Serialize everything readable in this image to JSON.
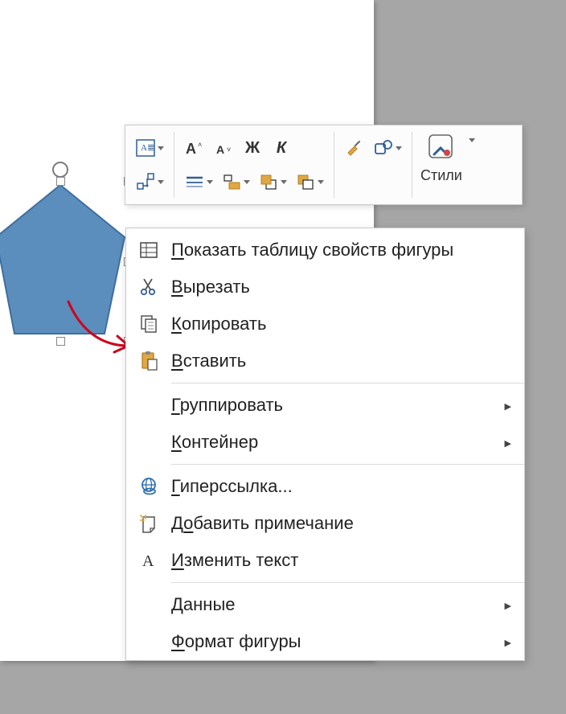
{
  "toolbar": {
    "styles_label": "Стили",
    "bold_glyph": "Ж",
    "italic_glyph": "К"
  },
  "context_menu": {
    "items": [
      {
        "icon": "properties-table-icon",
        "label_pre": "",
        "ul": "П",
        "label_post": "оказать таблицу свойств фигуры",
        "submenu": false
      },
      {
        "icon": "cut-icon",
        "label_pre": "",
        "ul": "В",
        "label_post": "ырезать",
        "submenu": false
      },
      {
        "icon": "copy-icon",
        "label_pre": "",
        "ul": "К",
        "label_post": "опировать",
        "submenu": false
      },
      {
        "icon": "paste-icon",
        "label_pre": "",
        "ul": "В",
        "label_post": "ставить",
        "submenu": false
      },
      {
        "sep": true
      },
      {
        "icon": "",
        "label_pre": "",
        "ul": "Г",
        "label_post": "руппировать",
        "submenu": true
      },
      {
        "icon": "",
        "label_pre": "",
        "ul": "К",
        "label_post": "онтейнер",
        "submenu": true
      },
      {
        "sep": true
      },
      {
        "icon": "hyperlink-icon",
        "label_pre": "",
        "ul": "Г",
        "label_post": "иперссылка...",
        "submenu": false
      },
      {
        "icon": "note-icon",
        "label_pre": "Д",
        "ul": "о",
        "label_post": "бавить примечание",
        "submenu": false
      },
      {
        "icon": "text-icon",
        "label_pre": "",
        "ul": "И",
        "label_post": "зменить текст",
        "submenu": false
      },
      {
        "sep": true
      },
      {
        "icon": "",
        "label_pre": "",
        "ul": "Д",
        "label_post": "анные",
        "submenu": true
      },
      {
        "icon": "",
        "label_pre": "",
        "ul": "Ф",
        "label_post": "ормат фигуры",
        "submenu": true
      }
    ]
  },
  "shape": {
    "fill": "#5b8dbd",
    "stroke": "#3f6f9d"
  }
}
